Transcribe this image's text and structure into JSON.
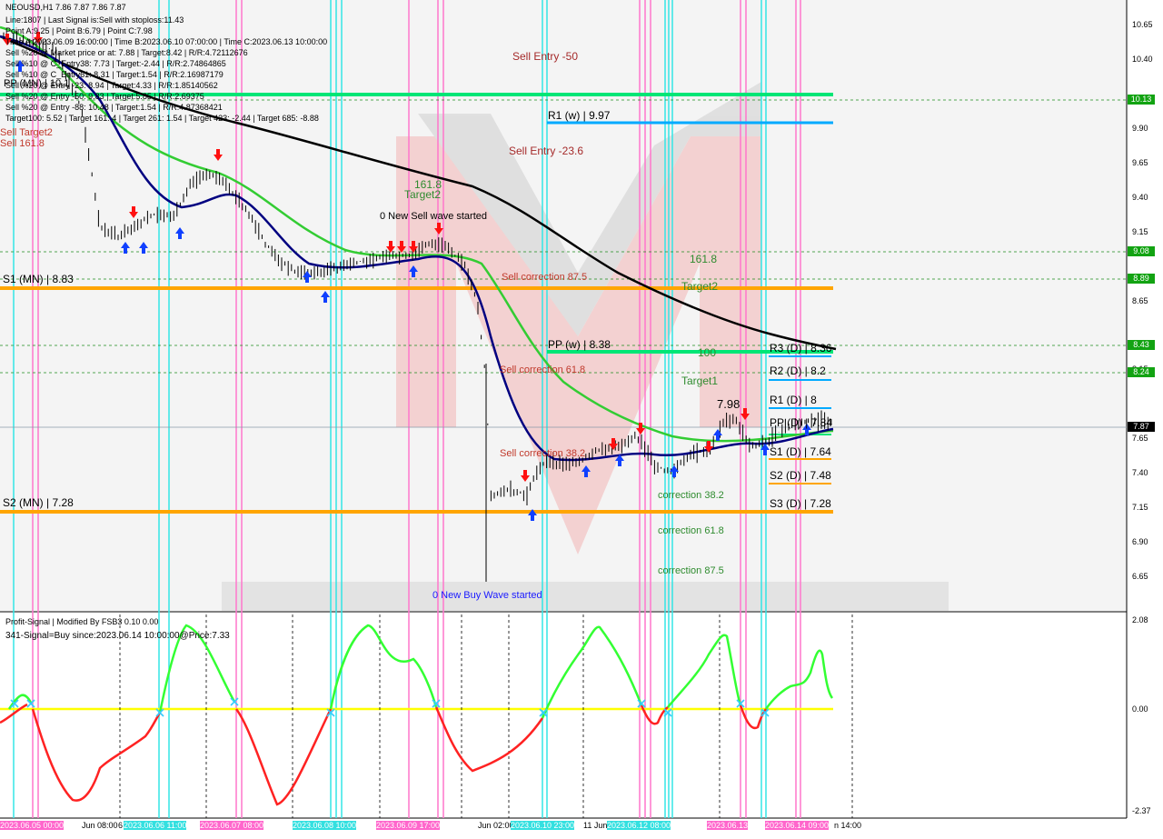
{
  "header": {
    "symbol_line": "NEOUSD,H1  7.86 7.87 7.86 7.87",
    "info_lines": [
      "Line:1807 | Last Signal is:Sell with stoploss:11.43",
      "Point A:9.25 | Point B:6.79 | Point C:7.98",
      "Time A:2023.06.09 16:00:00 | Time B:2023.06.10 07:00:00 | Time C:2023.06.13 10:00:00",
      "Sell %20 @ Market price or at: 7.88 | Target:8.42 | R/R:4.72112676",
      "Sell %10 @ C_Entry38: 7.73 | Target:-2.44 | R/R:2.74864865",
      "Sell %10 @ C_Entry61: 8.31 | Target:1.54 | R/R:2.16987179",
      "Sell %20 @ Entry -23: 8.94 | Target:4.33 | R/R:1.85140562",
      "Sell %20 @ Entry -50: 9.83 | Target:5.85 | R/R:2.69375",
      "Sell %20 @ Entry -88: 10.48 | Target:1.54 | R/R:4.87368421",
      "Target100: 5.52 | Target 161: 4 | Target 261: 1.54 | Target 423: -2.44 | Target 685: -8.88"
    ],
    "left_labels": [
      "PP (MN) | 10.1",
      "Sell Target2",
      "Sell 161.8"
    ]
  },
  "chart_labels": {
    "sell_entry_50": "Sell Entry -50",
    "r1_w": "R1 (w) | 9.97",
    "sell_entry_23": "Sell Entry -23.6",
    "l161_top": "161.8",
    "target2_top": "Target2",
    "new_sell_wave": "0 New Sell wave started",
    "l161_mid": "161.8",
    "sell_corr_875": "Sell correction 87.5",
    "target2_mid": "Target2",
    "s1_mn": "S1 (MN) | 8.83",
    "pp_w": "PP (w) | 8.38",
    "l100": "100",
    "r3_d": "R3 (D) | 8.36",
    "sell_corr_618": "Sell correction 61.8",
    "r2_d": "R2 (D) | 8.2",
    "target1": "Target1",
    "r1_d": "R1 (D) | 8",
    "pp_d": "PP (D) | 7.84",
    "c_label": "7.98",
    "sell_corr_382": "Sell correction 38.2",
    "s1_d": "S1 (D) | 7.64",
    "s2_d": "S2 (D) | 7.48",
    "corr_382": "correction 38.2",
    "s3_d": "S3 (D) | 7.28",
    "s2_mn": "S2 (MN) | 7.28",
    "corr_618": "correction 61.8",
    "corr_875": "correction 87.5",
    "new_buy_wave": "0 New Buy Wave started"
  },
  "price_axis": {
    "ticks": [
      "10.65",
      "10.40",
      "10.13",
      "9.90",
      "9.65",
      "9.40",
      "9.15",
      "9.08",
      "8.89",
      "8.65",
      "8.43",
      "8.24",
      "8.15",
      "7.87",
      "7.65",
      "7.40",
      "7.15",
      "6.90",
      "6.65"
    ],
    "tags": [
      {
        "value": "10.13",
        "color": "#12a312"
      },
      {
        "value": "9.08",
        "color": "#12a312"
      },
      {
        "value": "8.89",
        "color": "#12a312"
      },
      {
        "value": "8.43",
        "color": "#12a312"
      },
      {
        "value": "8.24",
        "color": "#12a312"
      },
      {
        "value": "7.87",
        "color": "#000000"
      }
    ]
  },
  "indicator": {
    "title": "Profit-Signal | Modified By FSB3 0.10 0.00",
    "signal_text": "341-Signal=Buy since:2023.06.14 10:00:00@Price:7.33",
    "axis": [
      "2.08",
      "0.00",
      "-2.37"
    ]
  },
  "time_axis": [
    {
      "label": "2023.06.05 00:00",
      "style": "hl"
    },
    {
      "label": "Jun 08:00",
      "style": ""
    },
    {
      "label": "6",
      "style": ""
    },
    {
      "label": "2023.06.06 11:00",
      "style": "hc"
    },
    {
      "label": "2023.06.07 08:00",
      "style": "hl"
    },
    {
      "label": "2023.06.08 10:00",
      "style": "hc"
    },
    {
      "label": "2023.06.09 17:00",
      "style": "hl"
    },
    {
      "label": "Jun 02:00",
      "style": ""
    },
    {
      "label": "2023.06.10 23:00",
      "style": "hc"
    },
    {
      "label": "11 Jun",
      "style": ""
    },
    {
      "label": "2023.06.12 08:00",
      "style": "hc"
    },
    {
      "label": "2023.06.13",
      "style": "hl"
    },
    {
      "label": "2023.06.14 09:00",
      "style": "hl"
    },
    {
      "label": "n 14:00",
      "style": ""
    }
  ],
  "colors": {
    "pivot_green": "#00e676",
    "pivot_blue": "#00aaff",
    "pivot_orange": "#ffa500",
    "ma_black": "#000000",
    "ma_green": "#33cc33",
    "ma_navy": "#000080",
    "signal_up": "#33ff33",
    "signal_down": "#ff2222",
    "zero_line": "#ffff00"
  }
}
